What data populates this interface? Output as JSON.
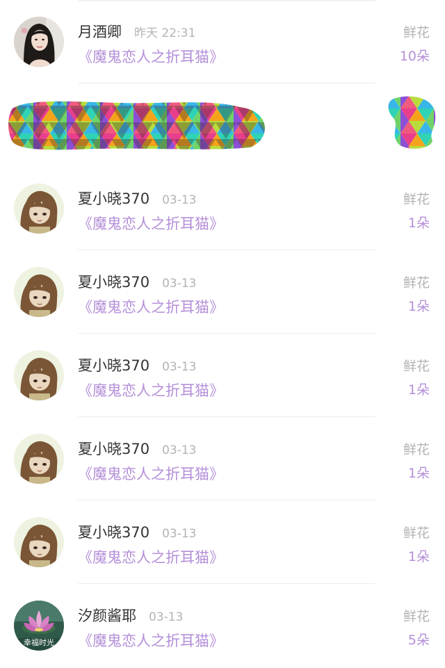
{
  "items": [
    {
      "user": "月酒卿",
      "time": "昨天 22:31",
      "book": "《魔鬼恋人之折耳猫》",
      "gift": "鲜花",
      "count": "10朵",
      "avatar": "woman-portrait-avatar"
    },
    {
      "redacted": true
    },
    {
      "user": "夏小晓370",
      "time": "03-13",
      "book": "《魔鬼恋人之折耳猫》",
      "gift": "鲜花",
      "count": "1朵",
      "avatar": "anime-girl-avatar"
    },
    {
      "user": "夏小晓370",
      "time": "03-13",
      "book": "《魔鬼恋人之折耳猫》",
      "gift": "鲜花",
      "count": "1朵",
      "avatar": "anime-girl-avatar"
    },
    {
      "user": "夏小晓370",
      "time": "03-13",
      "book": "《魔鬼恋人之折耳猫》",
      "gift": "鲜花",
      "count": "1朵",
      "avatar": "anime-girl-avatar"
    },
    {
      "user": "夏小晓370",
      "time": "03-13",
      "book": "《魔鬼恋人之折耳猫》",
      "gift": "鲜花",
      "count": "1朵",
      "avatar": "anime-girl-avatar"
    },
    {
      "user": "夏小晓370",
      "time": "03-13",
      "book": "《魔鬼恋人之折耳猫》",
      "gift": "鲜花",
      "count": "1朵",
      "avatar": "anime-girl-avatar"
    },
    {
      "user": "汐颜酱耶",
      "time": "03-13",
      "book": "《魔鬼恋人之折耳猫》",
      "gift": "鲜花",
      "count": "5朵",
      "avatar": "lotus-flower-avatar",
      "avatar_text": "幸福时光"
    }
  ],
  "colors": {
    "name": "#333333",
    "muted": "#b3b3b3",
    "accent": "#b48fd8"
  }
}
